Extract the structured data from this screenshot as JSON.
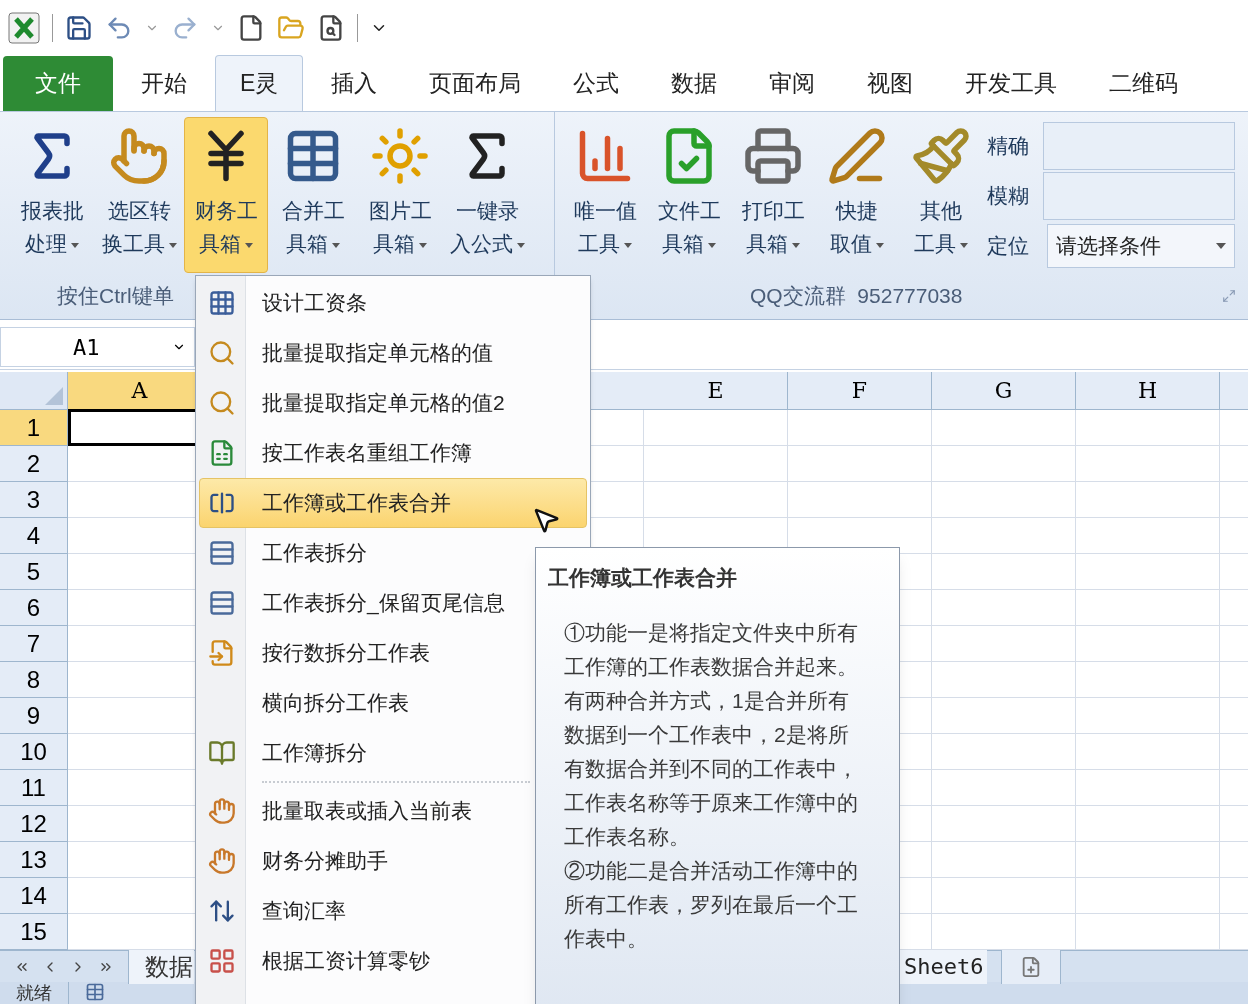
{
  "ribbon_tabs": [
    {
      "label": "文件",
      "kind": "file",
      "selected": false
    },
    {
      "label": "开始",
      "kind": "tab",
      "selected": false
    },
    {
      "label": "E灵",
      "kind": "tab",
      "selected": true
    },
    {
      "label": "插入",
      "kind": "tab",
      "selected": false
    },
    {
      "label": "页面布局",
      "kind": "tab",
      "selected": false
    },
    {
      "label": "公式",
      "kind": "tab",
      "selected": false
    },
    {
      "label": "数据",
      "kind": "tab",
      "selected": false
    },
    {
      "label": "审阅",
      "kind": "tab",
      "selected": false
    },
    {
      "label": "视图",
      "kind": "tab",
      "selected": false
    },
    {
      "label": "开发工具",
      "kind": "tab",
      "selected": false
    },
    {
      "label": "二维码",
      "kind": "tab",
      "selected": false
    }
  ],
  "ribbon": {
    "groups": [
      {
        "label": "按住Ctrl键单",
        "buttons": [
          {
            "line1": "报表批",
            "line2": "处理",
            "pressed": false
          },
          {
            "line1": "选区转",
            "line2": "换工具",
            "pressed": false
          },
          {
            "line1": "财务工",
            "line2": "具箱",
            "pressed": true
          },
          {
            "line1": "合并工",
            "line2": "具箱",
            "pressed": false
          },
          {
            "line1": "图片工",
            "line2": "具箱",
            "pressed": false
          },
          {
            "line1": "一键录",
            "line2": "入公式",
            "pressed": false
          }
        ]
      },
      {
        "label": "QQ交流群  952777038",
        "buttons": [
          {
            "line1": "唯一值",
            "line2": "工具",
            "pressed": false
          },
          {
            "line1": "文件工",
            "line2": "具箱",
            "pressed": false
          },
          {
            "line1": "打印工",
            "line2": "具箱",
            "pressed": false
          },
          {
            "line1": "快捷",
            "line2": "取值",
            "pressed": false
          },
          {
            "line1": "其他",
            "line2": "工具",
            "pressed": false
          }
        ],
        "locate": {
          "exact_label": "精确",
          "fuzzy_label": "模糊",
          "locate_label": "定位",
          "condition": "请选择条件"
        }
      }
    ]
  },
  "name_box": "A1",
  "columns": [
    {
      "label": "A",
      "selected": true
    },
    {
      "label": "E",
      "selected": false
    },
    {
      "label": "F",
      "selected": false
    },
    {
      "label": "G",
      "selected": false
    },
    {
      "label": "H",
      "selected": false
    }
  ],
  "rows": [
    {
      "label": "1",
      "selected": true
    },
    {
      "label": "2",
      "selected": false
    },
    {
      "label": "3",
      "selected": false
    },
    {
      "label": "4",
      "selected": false
    },
    {
      "label": "5",
      "selected": false
    },
    {
      "label": "6",
      "selected": false
    },
    {
      "label": "7",
      "selected": false
    },
    {
      "label": "8",
      "selected": false
    },
    {
      "label": "9",
      "selected": false
    },
    {
      "label": "10",
      "selected": false
    },
    {
      "label": "11",
      "selected": false
    },
    {
      "label": "12",
      "selected": false
    },
    {
      "label": "13",
      "selected": false
    },
    {
      "label": "14",
      "selected": false
    },
    {
      "label": "15",
      "selected": false
    }
  ],
  "sheet_tabs": [
    {
      "label": "数据"
    },
    {
      "label": "Sheet6"
    }
  ],
  "status_bar": {
    "text": "就绪"
  },
  "menu": [
    {
      "kind": "item",
      "label": "设计工资条",
      "selected": false
    },
    {
      "kind": "item",
      "label": "批量提取指定单元格的值",
      "selected": false
    },
    {
      "kind": "item",
      "label": "批量提取指定单元格的值2",
      "selected": false
    },
    {
      "kind": "item",
      "label": "按工作表名重组工作簿",
      "selected": false
    },
    {
      "kind": "item",
      "label": "工作簿或工作表合并",
      "selected": true
    },
    {
      "kind": "item",
      "label": "工作表拆分",
      "selected": false
    },
    {
      "kind": "item",
      "label": "工作表拆分_保留页尾信息",
      "selected": false
    },
    {
      "kind": "item",
      "label": "按行数拆分工作表",
      "selected": false
    },
    {
      "kind": "item",
      "label": "横向拆分工作表",
      "selected": false
    },
    {
      "kind": "item",
      "label": "工作簿拆分",
      "selected": false
    },
    {
      "kind": "separator"
    },
    {
      "kind": "item",
      "label": "批量取表或插入当前表",
      "selected": false
    },
    {
      "kind": "item",
      "label": "财务分摊助手",
      "selected": false
    },
    {
      "kind": "item",
      "label": "查询汇率",
      "selected": false
    },
    {
      "kind": "item",
      "label": "根据工资计算零钞",
      "selected": false
    }
  ],
  "tooltip": {
    "title": "工作簿或工作表合并",
    "paragraphs": [
      "①功能一是将指定文件夹中所有工作簿的工作表数据合并起来。有两种合并方式，1是合并所有数据到一个工作表中，2是将所有数据合并到不同的工作表中，工作表名称等于原来工作簿中的工作表名称。",
      "②功能二是合并活动工作簿中的所有工作表，罗列在最后一个工作表中。"
    ]
  }
}
